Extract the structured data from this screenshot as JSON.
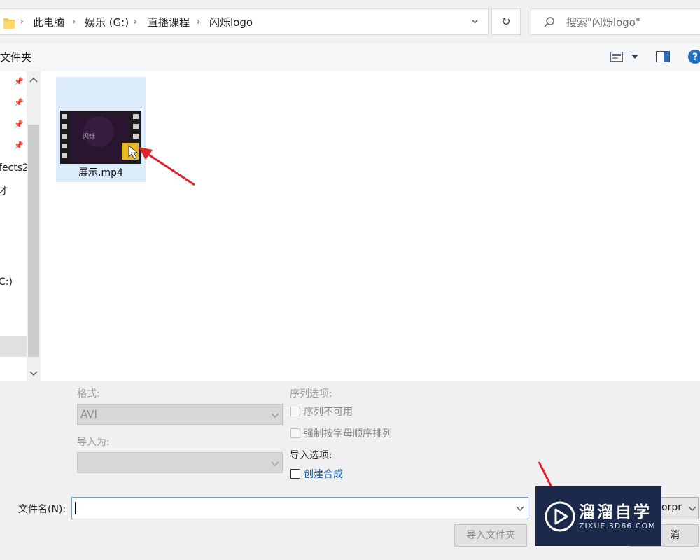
{
  "address_bar": {
    "breadcrumbs": [
      "此电脑",
      "娱乐 (G:)",
      "直播课程",
      "闪烁logo"
    ],
    "separator": "›",
    "dropdown_glyph": "⌄",
    "refresh_glyph": "↻",
    "search_placeholder": "搜索\"闪烁logo\""
  },
  "toolbar": {
    "new_folder_label": "文件夹"
  },
  "nav_pane": {
    "items": [
      "fects2",
      "才",
      "C:)"
    ]
  },
  "files": [
    {
      "name": "展示.mp4",
      "thumb_text": "闪烁"
    }
  ],
  "options": {
    "format_label": "格式:",
    "format_value": "AVI",
    "import_as_label": "导入为:",
    "import_as_value": "",
    "sequence_label": "序列选项:",
    "sequence_unavailable": "序列不可用",
    "force_alpha": "强制按字母顺序排列",
    "import_options_label": "导入选项:",
    "create_composition": "创建合成"
  },
  "filename_row": {
    "label": "文件名(N):",
    "value": "",
    "filetype_value": "orpr",
    "import_folder_button": "导入文件夹",
    "cancel_button": "消"
  },
  "watermark": {
    "main": "溜溜自学",
    "sub": "ZIXUE.3D66.COM"
  },
  "colors": {
    "selection": "#dcebfc",
    "annotation_arrow": "#e0202a",
    "link_blue": "#1a5fb4",
    "watermark_bg": "#1b2a4a"
  }
}
